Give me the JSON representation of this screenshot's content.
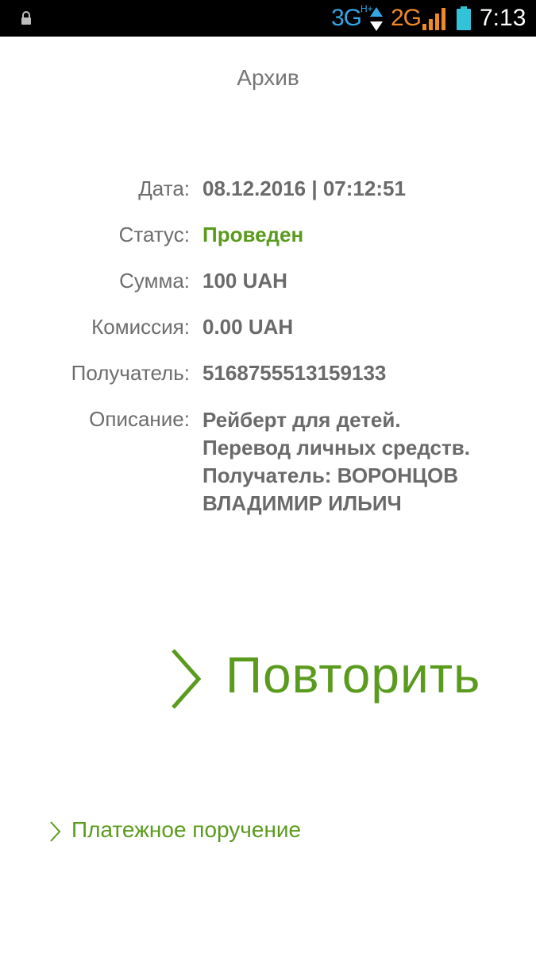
{
  "status_bar": {
    "network_primary": "3G",
    "network_primary_sub": "H+",
    "network_secondary": "2G",
    "time": "7:13",
    "icons": [
      "lock-icon",
      "data-updown-icon",
      "signal-icon",
      "battery-icon"
    ],
    "colors": {
      "primary_network": "#33a6e3",
      "secondary_network": "#f08a24",
      "battery": "#33c3d8"
    }
  },
  "header": {
    "title": "Архив"
  },
  "details": {
    "date": {
      "label": "Дата:",
      "value": "08.12.2016 | 07:12:51"
    },
    "status": {
      "label": "Статус:",
      "value": "Проведен"
    },
    "amount": {
      "label": "Сумма:",
      "value": "100 UAH"
    },
    "commission": {
      "label": "Комиссия:",
      "value": "0.00 UAH"
    },
    "recipient": {
      "label": "Получатель:",
      "value": "5168755513159133"
    },
    "description": {
      "label": "Описание:",
      "value": "Рейберт для детей. Перевод личных средств. Получатель: ВОРОНЦОВ ВЛАДИМИР ИЛЬИЧ"
    }
  },
  "actions": {
    "repeat_label": "Повторить",
    "payment_order_label": "Платежное поручение"
  },
  "colors": {
    "accent": "#5a9b1e",
    "label_text": "#6d6d6d",
    "value_text": "#6a6a6a"
  }
}
